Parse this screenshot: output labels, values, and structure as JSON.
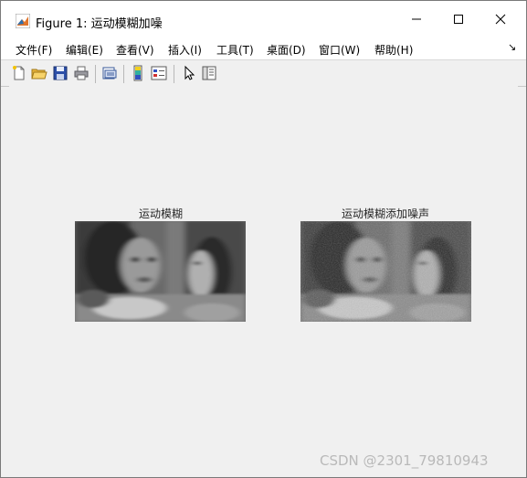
{
  "window": {
    "title": "Figure 1: 运动模糊加噪"
  },
  "menu": {
    "items": [
      "文件(F)",
      "编辑(E)",
      "查看(V)",
      "插入(I)",
      "工具(T)",
      "桌面(D)",
      "窗口(W)",
      "帮助(H)"
    ]
  },
  "toolbar": {
    "icons": [
      "new-figure-icon",
      "open-icon",
      "save-icon",
      "print-icon",
      "print-preview-icon",
      "colorbar-icon",
      "legend-icon",
      "pointer-icon",
      "property-editor-icon"
    ]
  },
  "axes": [
    {
      "title": "运动模糊"
    },
    {
      "title": "运动模糊添加噪声"
    }
  ],
  "watermark": "CSDN @2301_79810943"
}
